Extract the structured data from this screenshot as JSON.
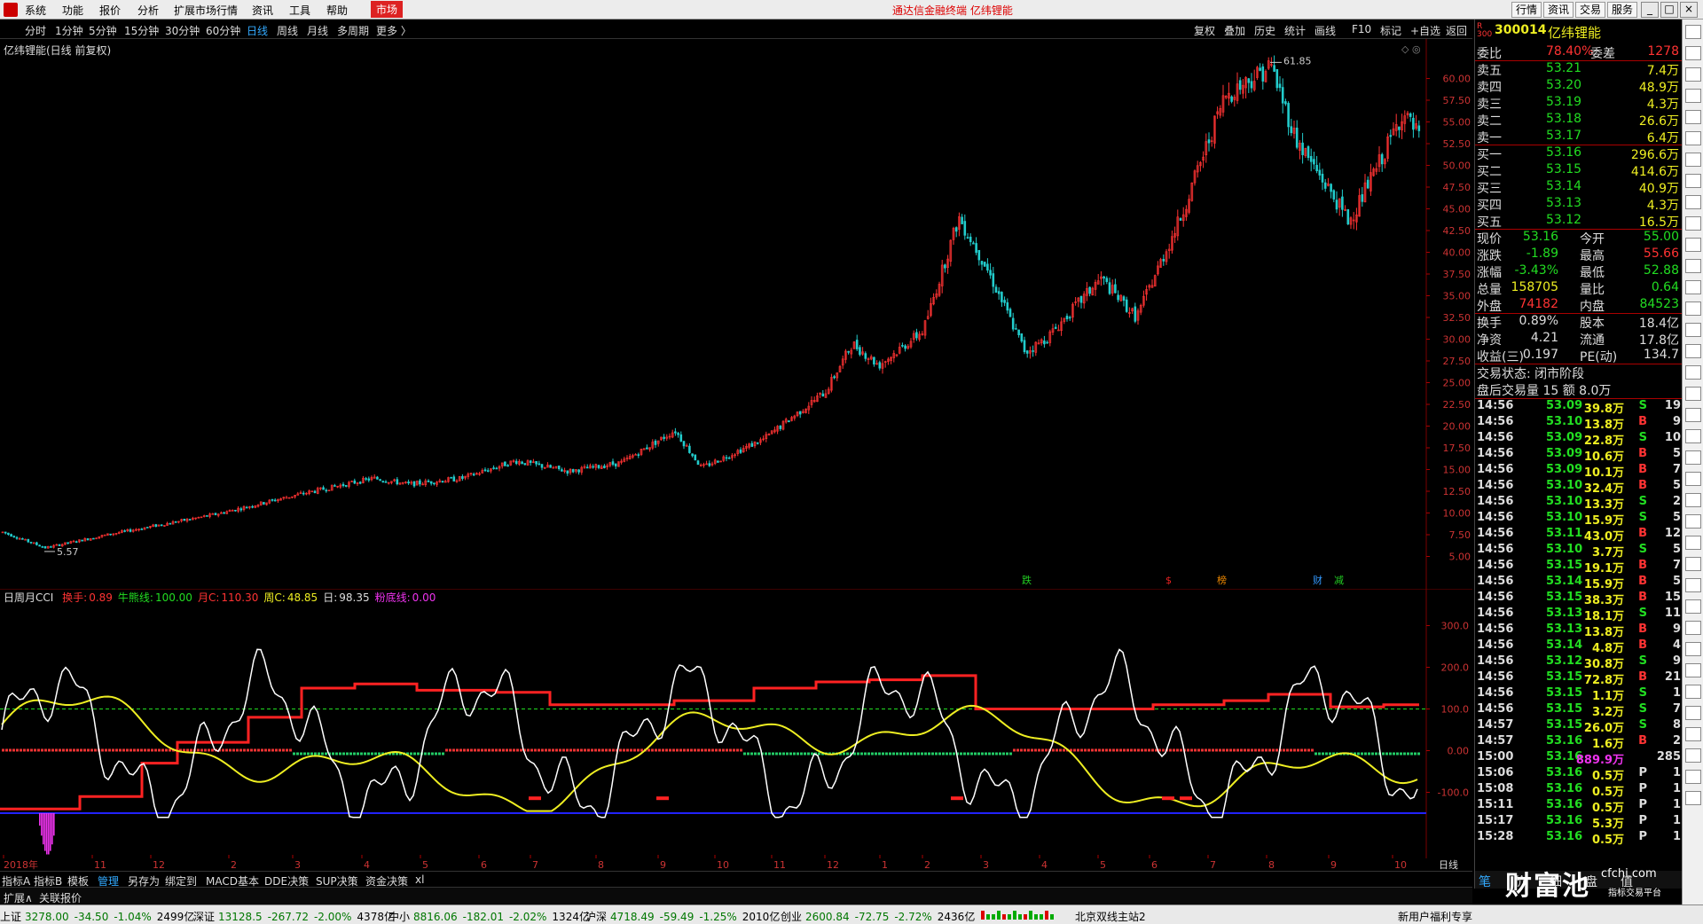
{
  "menubar": {
    "items": [
      "系统",
      "功能",
      "报价",
      "分析",
      "扩展市场行情",
      "资讯",
      "工具",
      "帮助"
    ],
    "market_label": "市场",
    "title": "通达信金融终端  亿纬锂能",
    "right_buttons": [
      "行情",
      "资讯",
      "交易",
      "服务"
    ],
    "window_buttons": [
      "_",
      "□",
      "×"
    ]
  },
  "toolbar": {
    "periods": [
      "分时",
      "1分钟",
      "5分钟",
      "15分钟",
      "30分钟",
      "60分钟",
      "日线",
      "周线",
      "月线",
      "多周期",
      "更多 〉"
    ],
    "active_period": "日线",
    "right_buttons": [
      "复权",
      "叠加",
      "历史",
      "统计",
      "画线",
      "F10",
      "标记",
      "+自选",
      "返回"
    ]
  },
  "main_chart": {
    "title": "亿纬锂能(日线 前复权)",
    "price_axis": [
      "60.00",
      "57.50",
      "55.00",
      "52.50",
      "50.00",
      "47.50",
      "45.00",
      "42.50",
      "40.00",
      "37.50",
      "35.00",
      "32.50",
      "30.00",
      "27.50",
      "25.00",
      "22.50",
      "20.00",
      "17.50",
      "15.00",
      "12.50",
      "10.00",
      "7.50",
      "5.00"
    ],
    "max_label": "61.85",
    "min_label": "5.57",
    "event_markers": [
      {
        "text": "跌",
        "color": "#2c2"
      },
      {
        "text": "$",
        "color": "#e22"
      },
      {
        "text": "榜",
        "color": "#e80"
      },
      {
        "text": "财",
        "color": "#39f"
      },
      {
        "text": "减",
        "color": "#2c2"
      }
    ]
  },
  "cci_chart": {
    "indicator_name": "日周月CCI",
    "legend": [
      {
        "label": "换手:",
        "value": "0.89",
        "color": "#f33"
      },
      {
        "label": "牛熊线:",
        "value": "100.00",
        "color": "#2d2"
      },
      {
        "label": "月C:",
        "value": "110.30",
        "color": "#f33"
      },
      {
        "label": "周C:",
        "value": "48.85",
        "color": "#ee2"
      },
      {
        "label": "日:",
        "value": "98.35",
        "color": "#ddd"
      },
      {
        "label": "粉底线:",
        "value": "0.00",
        "color": "#e3e"
      }
    ],
    "axis": [
      "300.0",
      "200.0",
      "100.0",
      "0.00",
      "-100.0"
    ],
    "time_axis": [
      "2018年",
      "11",
      "12",
      "2",
      "3",
      "4",
      "5",
      "6",
      "7",
      "8",
      "9",
      "10",
      "11",
      "12",
      "1",
      "2",
      "3",
      "4",
      "5",
      "6",
      "7",
      "8",
      "9",
      "10"
    ],
    "period_label": "日线"
  },
  "indicator_tabs": [
    "指标A",
    "指标B",
    "模板",
    "管理",
    "另存为",
    "绑定到",
    "MACD基本",
    "DDE决策",
    "SUP决策",
    "资金决策",
    "xl"
  ],
  "indicator_tab_active": "管理",
  "expand_row": [
    "扩展∧",
    "关联报价"
  ],
  "statusbar": [
    {
      "name": "上证",
      "value": "3278.00",
      "chg": "-34.50",
      "pct": "-1.04%",
      "amt": "2499亿"
    },
    {
      "name": "深证",
      "value": "13128.5",
      "chg": "-267.72",
      "pct": "-2.00%",
      "amt": "4378亿"
    },
    {
      "name": "中小",
      "value": "8816.06",
      "chg": "-182.01",
      "pct": "-2.02%",
      "amt": "1324亿"
    },
    {
      "name": "沪深",
      "value": "4718.49",
      "chg": "-59.49",
      "pct": "-1.25%",
      "amt": "2010亿"
    },
    {
      "name": "创业",
      "value": "2600.84",
      "chg": "-72.75",
      "pct": "-2.72%",
      "amt": "2436亿"
    }
  ],
  "status_server": "北京双线主站2",
  "status_promo": "新用户福利专享",
  "quote": {
    "code": "300014",
    "name": "亿纬锂能",
    "webi": {
      "label": "委比",
      "value": "78.40%",
      "diff_label": "委差",
      "diff": "1278"
    },
    "asks": [
      {
        "label": "卖五",
        "price": "53.21",
        "vol": "7.4万"
      },
      {
        "label": "卖四",
        "price": "53.20",
        "vol": "48.9万"
      },
      {
        "label": "卖三",
        "price": "53.19",
        "vol": "4.3万"
      },
      {
        "label": "卖二",
        "price": "53.18",
        "vol": "26.6万"
      },
      {
        "label": "卖一",
        "price": "53.17",
        "vol": "6.4万"
      }
    ],
    "bids": [
      {
        "label": "买一",
        "price": "53.16",
        "vol": "296.6万"
      },
      {
        "label": "买二",
        "price": "53.15",
        "vol": "414.6万"
      },
      {
        "label": "买三",
        "price": "53.14",
        "vol": "40.9万"
      },
      {
        "label": "买四",
        "price": "53.13",
        "vol": "4.3万"
      },
      {
        "label": "买五",
        "price": "53.12",
        "vol": "16.5万"
      }
    ],
    "stats": [
      {
        "l1": "现价",
        "v1": "53.16",
        "c1": "#2d2",
        "l2": "今开",
        "v2": "55.00",
        "c2": "#2d2"
      },
      {
        "l1": "涨跌",
        "v1": "-1.89",
        "c1": "#2d2",
        "l2": "最高",
        "v2": "55.66",
        "c2": "#f33"
      },
      {
        "l1": "涨幅",
        "v1": "-3.43%",
        "c1": "#2d2",
        "l2": "最低",
        "v2": "52.88",
        "c2": "#2d2"
      },
      {
        "l1": "总量",
        "v1": "158705",
        "c1": "#ee2",
        "l2": "量比",
        "v2": "0.64",
        "c2": "#2d2"
      },
      {
        "l1": "外盘",
        "v1": "74182",
        "c1": "#f33",
        "l2": "内盘",
        "v2": "84523",
        "c2": "#2d2"
      }
    ],
    "stats2": [
      {
        "l1": "换手",
        "v1": "0.89%",
        "l2": "股本",
        "v2": "18.4亿"
      },
      {
        "l1": "净资",
        "v1": "4.21",
        "l2": "流通",
        "v2": "17.8亿"
      },
      {
        "l1": "收益(三)",
        "v1": "0.197",
        "l2": "PE(动)",
        "v2": "134.7"
      }
    ],
    "trade_status": "交易状态: 闭市阶段",
    "after_hours": "盘后交易量 15 额 8.0万",
    "ticks": [
      {
        "t": "14:56",
        "p": "53.09",
        "v": "39.8万",
        "bs": "S",
        "n": "19"
      },
      {
        "t": "14:56",
        "p": "53.10",
        "v": "13.8万",
        "bs": "B",
        "n": "9"
      },
      {
        "t": "14:56",
        "p": "53.09",
        "v": "22.8万",
        "bs": "S",
        "n": "10"
      },
      {
        "t": "14:56",
        "p": "53.09",
        "v": "10.6万",
        "bs": "B",
        "n": "5"
      },
      {
        "t": "14:56",
        "p": "53.09",
        "v": "10.1万",
        "bs": "B",
        "n": "7"
      },
      {
        "t": "14:56",
        "p": "53.10",
        "v": "32.4万",
        "bs": "B",
        "n": "5"
      },
      {
        "t": "14:56",
        "p": "53.10",
        "v": "13.3万",
        "bs": "S",
        "n": "2"
      },
      {
        "t": "14:56",
        "p": "53.10",
        "v": "15.9万",
        "bs": "S",
        "n": "5"
      },
      {
        "t": "14:56",
        "p": "53.11",
        "v": "43.0万",
        "bs": "B",
        "n": "12"
      },
      {
        "t": "14:56",
        "p": "53.10",
        "v": "3.7万",
        "bs": "S",
        "n": "5"
      },
      {
        "t": "14:56",
        "p": "53.15",
        "v": "19.1万",
        "bs": "B",
        "n": "7"
      },
      {
        "t": "14:56",
        "p": "53.14",
        "v": "15.9万",
        "bs": "B",
        "n": "5"
      },
      {
        "t": "14:56",
        "p": "53.15",
        "v": "38.3万",
        "bs": "B",
        "n": "15"
      },
      {
        "t": "14:56",
        "p": "53.13",
        "v": "18.1万",
        "bs": "S",
        "n": "11"
      },
      {
        "t": "14:56",
        "p": "53.13",
        "v": "13.8万",
        "bs": "B",
        "n": "9"
      },
      {
        "t": "14:56",
        "p": "53.14",
        "v": "4.8万",
        "bs": "B",
        "n": "4"
      },
      {
        "t": "14:56",
        "p": "53.12",
        "v": "30.8万",
        "bs": "S",
        "n": "9"
      },
      {
        "t": "14:56",
        "p": "53.15",
        "v": "72.8万",
        "bs": "B",
        "n": "21"
      },
      {
        "t": "14:56",
        "p": "53.15",
        "v": "1.1万",
        "bs": "S",
        "n": "1"
      },
      {
        "t": "14:56",
        "p": "53.15",
        "v": "3.2万",
        "bs": "S",
        "n": "7"
      },
      {
        "t": "14:57",
        "p": "53.15",
        "v": "26.0万",
        "bs": "S",
        "n": "8"
      },
      {
        "t": "14:57",
        "p": "53.16",
        "v": "1.6万",
        "bs": "B",
        "n": "2"
      },
      {
        "t": "15:00",
        "p": "53.16",
        "v": "889.9万",
        "bs": "",
        "n": "285"
      },
      {
        "t": "15:06",
        "p": "53.16",
        "v": "0.5万",
        "bs": "P",
        "n": "1"
      },
      {
        "t": "15:08",
        "p": "53.16",
        "v": "0.5万",
        "bs": "P",
        "n": "1"
      },
      {
        "t": "15:11",
        "p": "53.16",
        "v": "0.5万",
        "bs": "P",
        "n": "1"
      },
      {
        "t": "15:17",
        "p": "53.16",
        "v": "5.3万",
        "bs": "P",
        "n": "1"
      },
      {
        "t": "15:28",
        "p": "53.16",
        "v": "0.5万",
        "bs": "P",
        "n": "1"
      }
    ],
    "bottom_tabs": [
      "笔",
      "价",
      "细",
      "盘",
      "值"
    ]
  },
  "watermark": {
    "brand": "财富池",
    "domain": "cfchi.com",
    "sub": "指标交易平台"
  },
  "colors": {
    "up": "#f33",
    "down": "#2cc",
    "green": "#2d2",
    "yellow": "#ee2",
    "bg": "#000"
  }
}
